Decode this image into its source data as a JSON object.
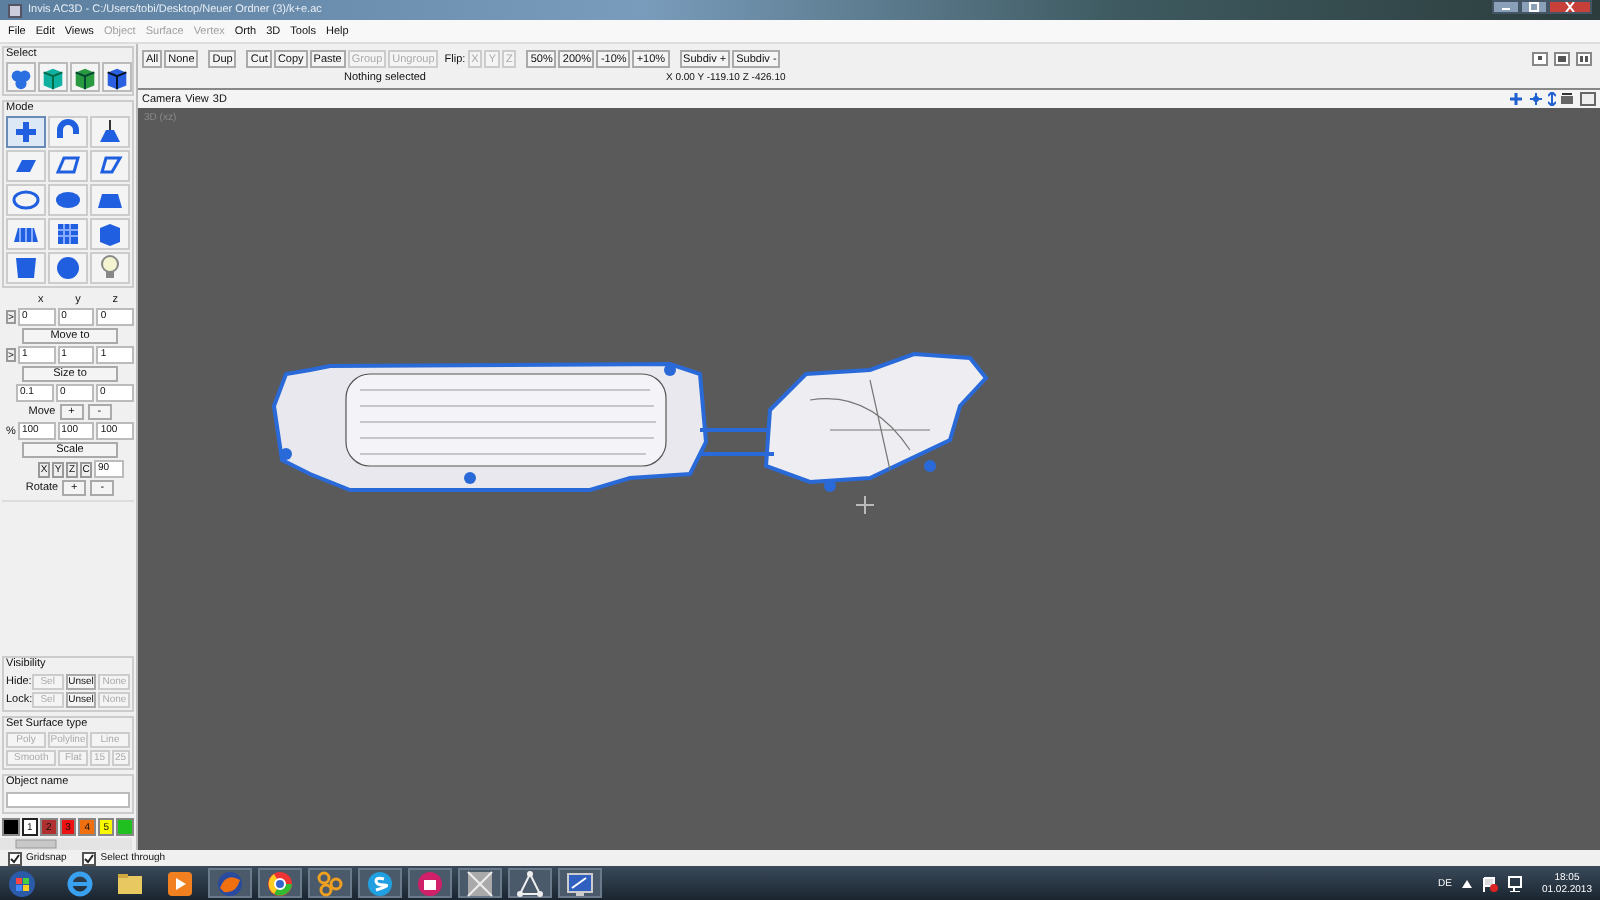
{
  "window": {
    "title": "Invis AC3D - C:/Users/tobi/Desktop/Neuer Ordner (3)/k+e.ac"
  },
  "menu": [
    {
      "label": "File",
      "disabled": false
    },
    {
      "label": "Edit",
      "disabled": false
    },
    {
      "label": "Views",
      "disabled": false
    },
    {
      "label": "Object",
      "disabled": true
    },
    {
      "label": "Surface",
      "disabled": true
    },
    {
      "label": "Vertex",
      "disabled": true
    },
    {
      "label": "Orth",
      "disabled": false
    },
    {
      "label": "3D",
      "disabled": false
    },
    {
      "label": "Tools",
      "disabled": false
    },
    {
      "label": "Help",
      "disabled": false
    }
  ],
  "toolbar": [
    {
      "label": "All",
      "disabled": false
    },
    {
      "label": "None",
      "disabled": false
    },
    {
      "label": "Dup",
      "disabled": false
    },
    {
      "label": "Cut",
      "disabled": false
    },
    {
      "label": "Copy",
      "disabled": false
    },
    {
      "label": "Paste",
      "disabled": false
    },
    {
      "label": "Group",
      "disabled": true
    },
    {
      "label": "Ungroup",
      "disabled": true
    },
    {
      "label": "Flip:",
      "kind": "label"
    },
    {
      "label": "X",
      "disabled": true
    },
    {
      "label": "Y",
      "disabled": true
    },
    {
      "label": "Z",
      "disabled": true
    },
    {
      "label": "50%",
      "disabled": false
    },
    {
      "label": "200%",
      "disabled": false
    },
    {
      "label": "-10%",
      "disabled": false
    },
    {
      "label": "+10%",
      "disabled": false
    },
    {
      "label": "Subdiv +",
      "disabled": false
    },
    {
      "label": "Subdiv -",
      "disabled": false
    }
  ],
  "status": "Nothing selected",
  "coordinates": "X 0.00 Y -119.10 Z -426.10",
  "select_panel": {
    "title": "Select",
    "modes": [
      {
        "selected": false
      },
      {
        "selected": false
      },
      {
        "selected": false
      },
      {
        "selected": false
      }
    ]
  },
  "mode_panel": {
    "title": "Mode",
    "tools": [
      {
        "selected": true
      },
      {
        "selected": false
      },
      {
        "selected": false
      },
      {
        "selected": false
      },
      {
        "selected": false
      },
      {
        "selected": false
      },
      {
        "selected": false
      },
      {
        "selected": false
      },
      {
        "selected": false
      },
      {
        "selected": false
      },
      {
        "selected": false
      },
      {
        "selected": false
      },
      {
        "selected": false
      },
      {
        "selected": false
      },
      {
        "selected": false
      }
    ]
  },
  "transform": {
    "axes": [
      "x",
      "y",
      "z"
    ],
    "position": {
      "toggle": ">",
      "values": [
        "0",
        "0",
        "0"
      ],
      "button": "Move to"
    },
    "size": {
      "toggle": ">",
      "values": [
        "1",
        "1",
        "1"
      ],
      "button": "Size to"
    },
    "move": {
      "values": [
        "0.1",
        "0",
        "0"
      ],
      "label": "Move",
      "plus": "+",
      "minus": "-"
    },
    "scale": {
      "prefix": "%",
      "values": [
        "100",
        "100",
        "100"
      ],
      "button": "Scale"
    },
    "rotate": {
      "axis_buttons": [
        "X",
        "Y",
        "Z",
        "C"
      ],
      "angle": "90",
      "label": "Rotate",
      "plus": "+",
      "minus": "-"
    }
  },
  "visibility": {
    "title": "Visibility",
    "rows": [
      {
        "label": "Hide:",
        "buttons": [
          {
            "label": "Sel",
            "disabled": true
          },
          {
            "label": "Unsel",
            "disabled": false
          },
          {
            "label": "None",
            "disabled": true
          }
        ]
      },
      {
        "label": "Lock:",
        "buttons": [
          {
            "label": "Sel",
            "disabled": true
          },
          {
            "label": "Unsel",
            "disabled": false
          },
          {
            "label": "None",
            "disabled": true
          }
        ]
      }
    ]
  },
  "surface_type": {
    "title": "Set Surface type",
    "buttons": [
      {
        "label": "Poly",
        "disabled": true
      },
      {
        "label": "Polyline",
        "disabled": true
      },
      {
        "label": "Line",
        "disabled": true
      },
      {
        "label": "Smooth",
        "disabled": true
      },
      {
        "label": "Flat",
        "disabled": true
      },
      {
        "label": "15",
        "disabled": true
      },
      {
        "label": "25",
        "disabled": true
      }
    ]
  },
  "object_name": {
    "title": "Object name"
  },
  "palette": [
    {
      "color": "#000000",
      "selected": false
    },
    {
      "color": "#ffffff",
      "label": "1",
      "selected": true
    },
    {
      "color": "#b03030",
      "label": "2",
      "selected": false
    },
    {
      "color": "#ee1111",
      "label": "3",
      "selected": false
    },
    {
      "color": "#f07010",
      "label": "4",
      "selected": false
    },
    {
      "color": "#f8f800",
      "label": "5",
      "selected": false
    },
    {
      "color": "#20c020",
      "selected": false
    }
  ],
  "viewport": {
    "menu": [
      "Camera",
      "View",
      "3D"
    ],
    "label": "3D (xz)"
  },
  "options": [
    {
      "label": "Gridsnap",
      "checked": true
    },
    {
      "label": "Select through",
      "checked": true
    }
  ],
  "tray": {
    "language": "DE",
    "time": "18:05",
    "date": "01.02.2013"
  }
}
